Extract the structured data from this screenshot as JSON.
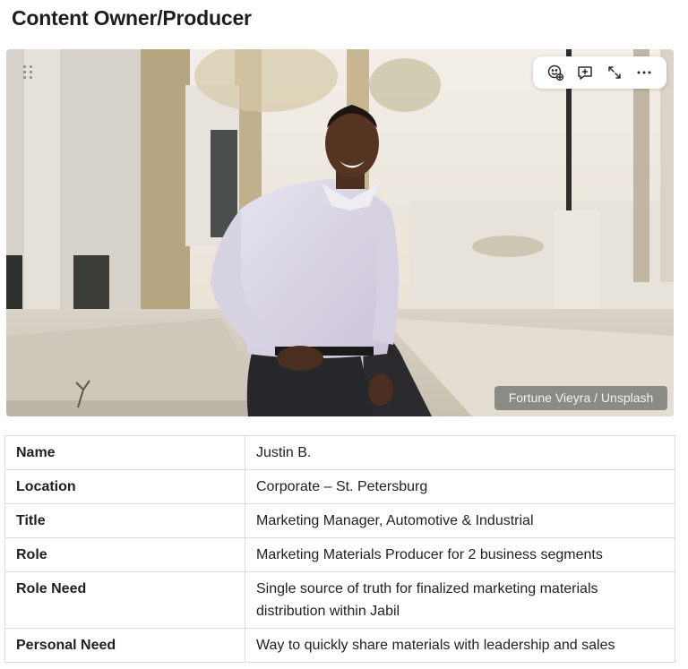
{
  "page": {
    "title": "Content Owner/Producer"
  },
  "image": {
    "credit": "Fortune Vieyra / Unsplash",
    "toolbar": [
      {
        "icon": "emoji-add-icon",
        "action": "Add reaction"
      },
      {
        "icon": "comment-add-icon",
        "action": "Add comment"
      },
      {
        "icon": "expand-icon",
        "action": "Expand"
      },
      {
        "icon": "more-icon",
        "action": "More"
      }
    ]
  },
  "table": {
    "rows": [
      {
        "label": "Name",
        "value": "Justin B."
      },
      {
        "label": "Location",
        "value": "Corporate – St. Petersburg"
      },
      {
        "label": "Title",
        "value": "Marketing Manager, Automotive & Industrial"
      },
      {
        "label": "Role",
        "value": "Marketing Materials Producer for 2 business segments"
      },
      {
        "label": "Role Need",
        "value": "Single source of truth for finalized marketing materials distribution within Jabil"
      },
      {
        "label": "Personal Need",
        "value": "Way to quickly share materials with leadership and sales"
      }
    ]
  },
  "colors": {
    "border": "#dcdcdc",
    "text": "#1f1f1f",
    "credit_bg": "#464646"
  }
}
